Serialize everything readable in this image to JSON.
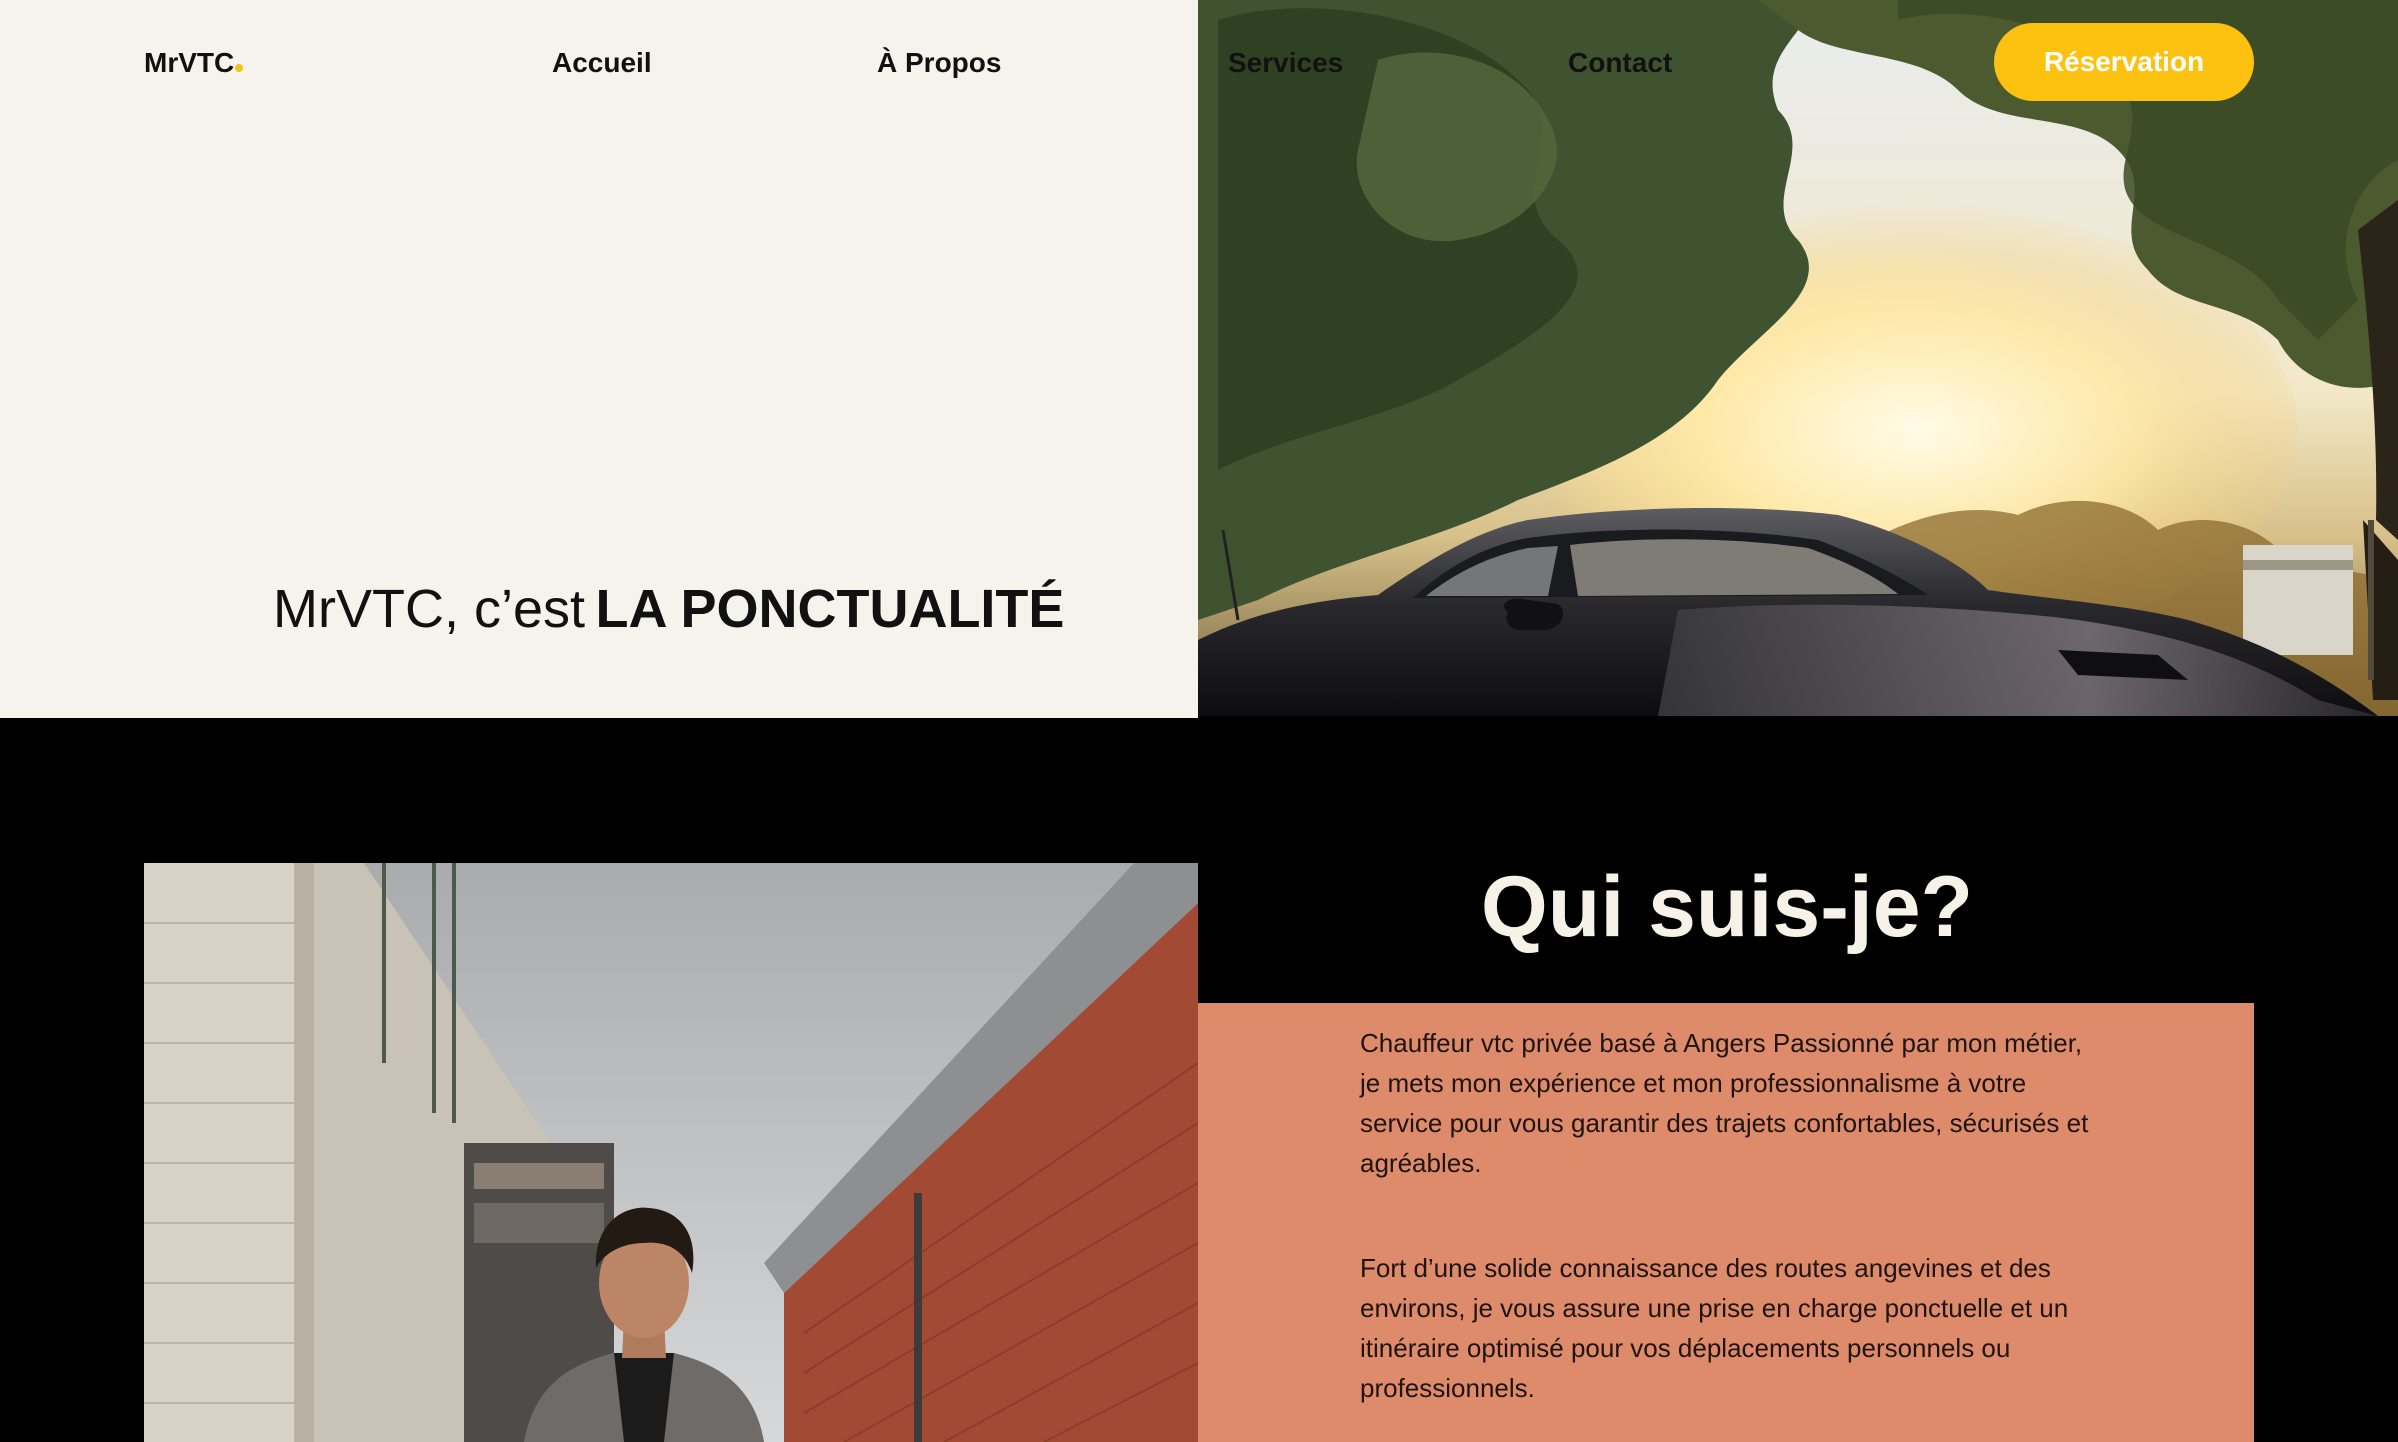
{
  "nav": {
    "logo": "MrVTC",
    "links": [
      "Accueil",
      "À Propos",
      "Services",
      "Contact"
    ],
    "cta": "Réservation"
  },
  "hero": {
    "tagline_prefix": "MrVTC, c’est",
    "tagline_emphasis": "LA PONCTUALITÉ"
  },
  "about": {
    "title": "Qui suis-je?",
    "paragraph_1": "Chauffeur vtc privée basé à Angers Passionné par mon métier, je mets mon expérience et mon professionnalisme à votre service pour vous garantir des trajets confortables, sécurisés et agréables.",
    "paragraph_2": "Fort d’une solide connaissance des routes angevines et des environs, je vous assure une prise en charge ponctuelle et un itinéraire optimisé pour vos déplacements personnels ou professionnels."
  },
  "colors": {
    "accent": "#fcc20f",
    "hero_bg": "#f6f3ed",
    "card_bg": "#de8b6c",
    "section_bg": "#000000"
  }
}
